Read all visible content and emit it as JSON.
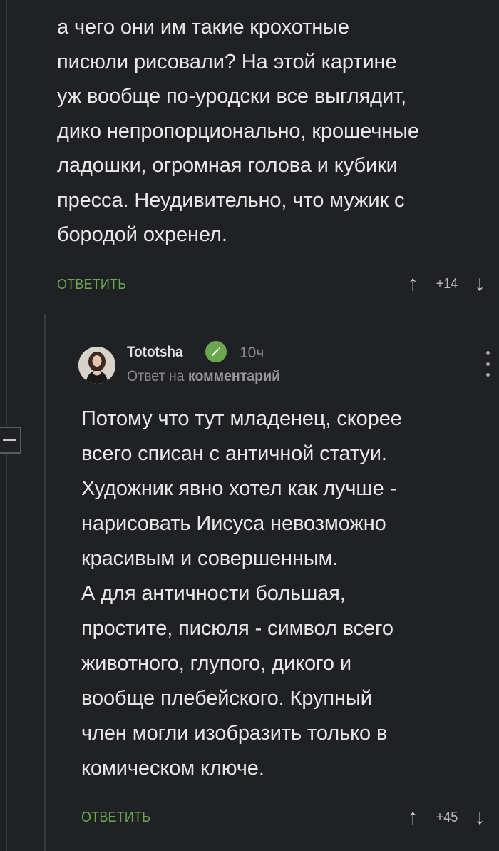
{
  "comment1": {
    "text": "а чего они им такие крохотные\nписюли рисовали? На этой картине\nуж вообще по-уродски все выглядит,\nдико непропорционально, крошечные\nладошки, огромная голова и кубики\nпресса. Неудивительно, что мужик с\nбородой охренел.",
    "reply_label": "ОТВЕТИТЬ",
    "score": "+14"
  },
  "comment2": {
    "username": "Tototsha",
    "time": "10ч",
    "reply_prefix": "Ответ на",
    "reply_target": "комментарий",
    "text": "Потому что тут младенец, скорее\nвсего списан с античной статуи.\nХудожник явно хотел как лучше -\nнарисовать Иисуса невозможно\nкрасивым и совершенным.\nА для античности большая,\nпростите, писюля - символ всего\nживотного, глупого, дикого и\nвообще плебейского. Крупный\nчлен могли изобразить только в\nкомическом ключе.",
    "reply_label": "ОТВЕТИТЬ",
    "score": "+45"
  },
  "icons": {
    "upvote": "↑",
    "downvote": "↓",
    "verified": "pencil-check-icon",
    "more": "vertical-dots-icon",
    "collapse": "minus-icon"
  },
  "colors": {
    "background": "#202124",
    "accent": "#6aa84f",
    "text": "#e8e8e8",
    "muted": "#8a8a8a"
  }
}
